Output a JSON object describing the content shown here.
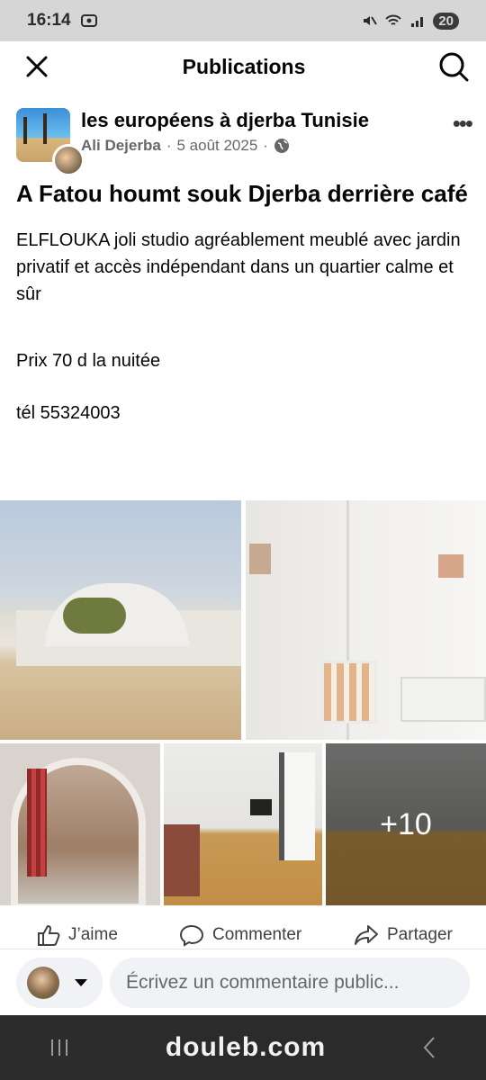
{
  "status_bar": {
    "time": "16:14",
    "battery": "20"
  },
  "header": {
    "title": "Publications"
  },
  "post": {
    "group_name": "les européens à djerba Tunisie",
    "author": "Ali Dejerba",
    "date": "5 août 2025",
    "separator": "·",
    "title": "A Fatou houmt souk Djerba derrière café",
    "body_1": "ELFLOUKA joli studio agréablement meublé avec jardin privatif et accès indépendant dans un quartier calme et sûr",
    "body_2": "Prix 70 d la nuitée",
    "body_3": "tél 55324003",
    "more_photos": "+10"
  },
  "actions": {
    "like": "J’aime",
    "comment": "Commenter",
    "share": "Partager"
  },
  "comment_bar": {
    "placeholder": "Écrivez un commentaire public..."
  },
  "watermark": "douleb.com"
}
